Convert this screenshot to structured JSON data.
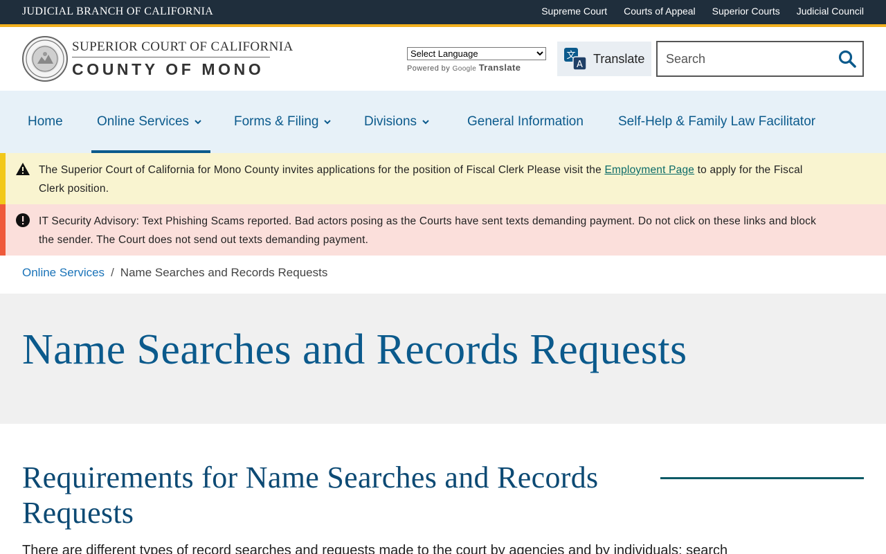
{
  "utility": {
    "branch": "JUDICIAL BRANCH OF CALIFORNIA",
    "links": [
      "Supreme Court",
      "Courts of Appeal",
      "Superior Courts",
      "Judicial Council"
    ]
  },
  "header": {
    "court_line1": "SUPERIOR COURT OF CALIFORNIA",
    "court_line2": "COUNTY OF MONO",
    "language_select": "Select Language",
    "powered_by": "Powered by",
    "google": "Google",
    "translate_brand": "Translate",
    "translate_button": "Translate",
    "search_placeholder": "Search"
  },
  "nav": {
    "home": "Home",
    "online_services": "Online Services",
    "forms_filing": "Forms & Filing",
    "divisions": "Divisions",
    "general_info": "General Information",
    "self_help": "Self-Help & Family Law Facilitator"
  },
  "alerts": {
    "warning": {
      "text_before": "The Superior Court of California for Mono County invites applications for the position of Fiscal Clerk Please visit the ",
      "link": "Employment Page",
      "text_after": " to apply for the Fiscal Clerk position."
    },
    "danger": {
      "text": "IT Security Advisory: Text Phishing Scams reported. Bad actors posing as the Courts have sent texts demanding payment. Do not click on these links and block the sender. The Court does not send out texts demanding payment."
    }
  },
  "breadcrumb": {
    "parent": "Online Services",
    "separator": "/",
    "current": "Name Searches and Records Requests"
  },
  "page_title": "Name Searches and Records Requests",
  "section": {
    "heading": "Requirements for Name Searches and Records Requests",
    "body_partial": "There are different types of record searches and requests made to the court by agencies and by individuals; search"
  },
  "colors": {
    "utility_bar": "#1f2e3c",
    "accent_gold": "#f2b01e",
    "nav_bg": "#e7f1f8",
    "link_blue": "#0b5a8c",
    "warning_bg": "#f9f4d0",
    "danger_bg": "#fbdfdb"
  }
}
